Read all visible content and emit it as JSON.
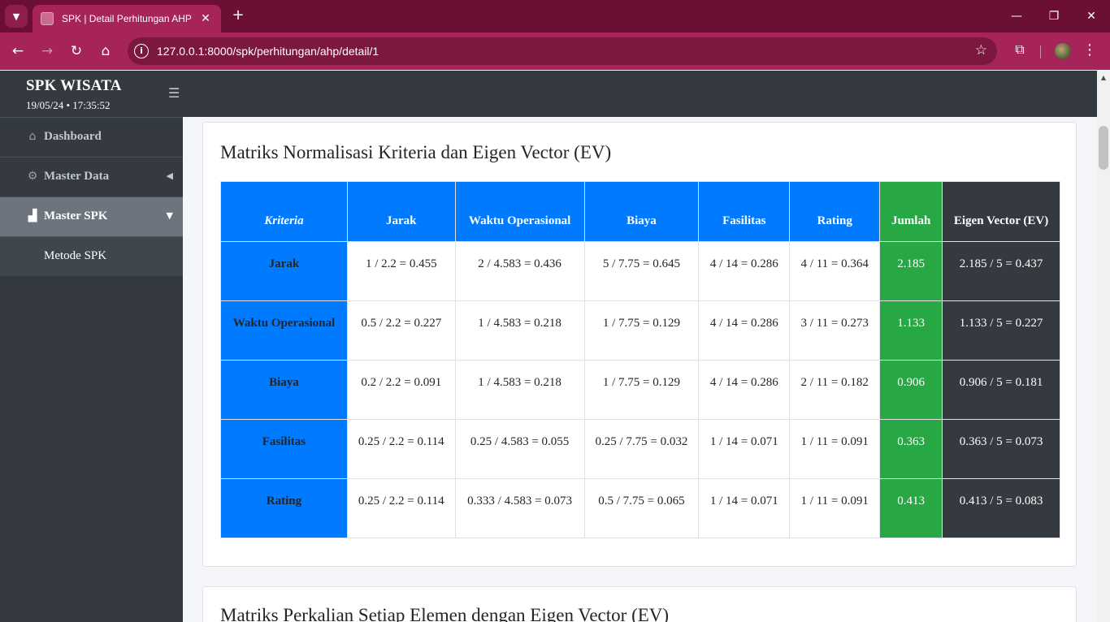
{
  "browser": {
    "tab_title": "SPK | Detail Perhitungan AHP",
    "url": "127.0.0.1:8000/spk/perhitungan/ahp/detail/1",
    "accent": "#a6245a"
  },
  "sidebar": {
    "brand": "SPK WISATA",
    "datetime": "19/05/24 • 17:35:52",
    "items": [
      {
        "label": "Dashboard",
        "icon": "home-icon"
      },
      {
        "label": "Master Data",
        "icon": "cubes-icon"
      },
      {
        "label": "Master SPK",
        "icon": "sitemap-icon"
      },
      {
        "label": "Metode SPK",
        "icon": ""
      }
    ]
  },
  "card1": {
    "title": "Matriks Normalisasi Kriteria dan Eigen Vector (EV)",
    "headers": [
      "Kriteria",
      "Jarak",
      "Waktu Operasional",
      "Biaya",
      "Fasilitas",
      "Rating",
      "Jumlah",
      "Eigen Vector (EV)"
    ],
    "rows": [
      {
        "kriteria": "Jarak",
        "cells": [
          "1 / 2.2 = 0.455",
          "2 / 4.583 = 0.436",
          "5 / 7.75 = 0.645",
          "4 / 14 = 0.286",
          "4 / 11 = 0.364"
        ],
        "jumlah": "2.185",
        "ev": "2.185 / 5 = 0.437"
      },
      {
        "kriteria": "Waktu Operasional",
        "cells": [
          "0.5 / 2.2 = 0.227",
          "1 / 4.583 = 0.218",
          "1 / 7.75 = 0.129",
          "4 / 14 = 0.286",
          "3 / 11 = 0.273"
        ],
        "jumlah": "1.133",
        "ev": "1.133 / 5 = 0.227"
      },
      {
        "kriteria": "Biaya",
        "cells": [
          "0.2 / 2.2 = 0.091",
          "1 / 4.583 = 0.218",
          "1 / 7.75 = 0.129",
          "4 / 14 = 0.286",
          "2 / 11 = 0.182"
        ],
        "jumlah": "0.906",
        "ev": "0.906 / 5 = 0.181"
      },
      {
        "kriteria": "Fasilitas",
        "cells": [
          "0.25 / 2.2 = 0.114",
          "0.25 / 4.583 = 0.055",
          "0.25 / 7.75 = 0.032",
          "1 / 14 = 0.071",
          "1 / 11 = 0.091"
        ],
        "jumlah": "0.363",
        "ev": "0.363 / 5 = 0.073"
      },
      {
        "kriteria": "Rating",
        "cells": [
          "0.25 / 2.2 = 0.114",
          "0.333 / 4.583 = 0.073",
          "0.5 / 7.75 = 0.065",
          "1 / 14 = 0.071",
          "1 / 11 = 0.091"
        ],
        "jumlah": "0.413",
        "ev": "0.413 / 5 = 0.083"
      }
    ]
  },
  "card2": {
    "title": "Matriks Perkalian Setiap Elemen dengan Eigen Vector (EV)"
  }
}
